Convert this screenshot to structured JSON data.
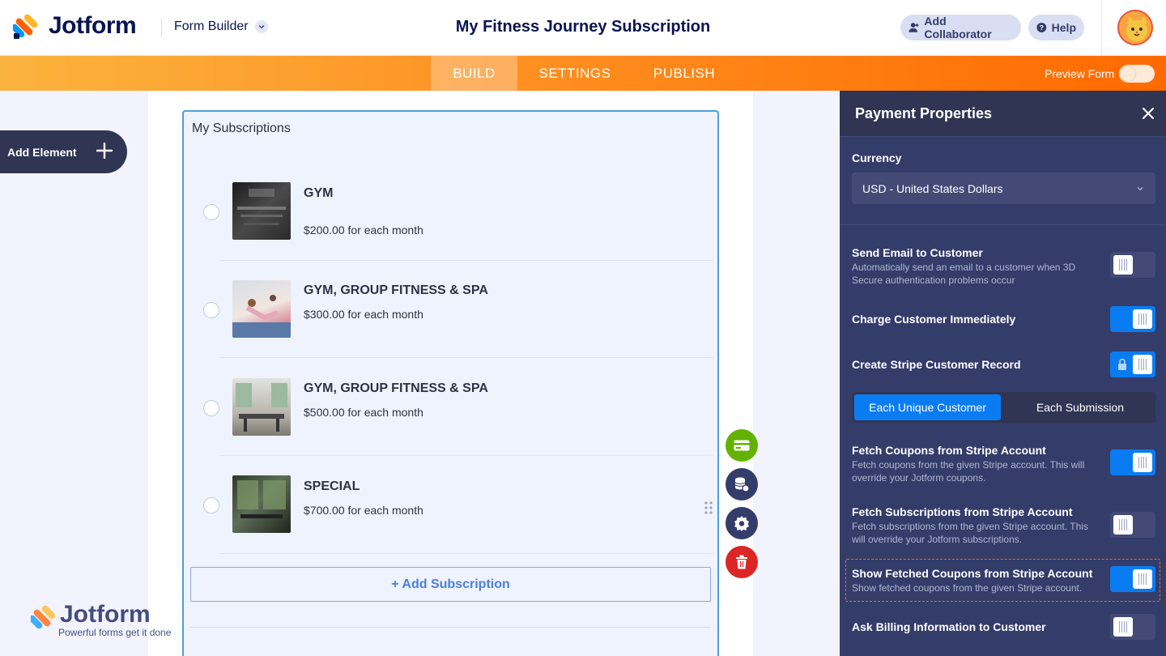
{
  "header": {
    "brand": "Jotform",
    "builder_menu": "Form Builder",
    "form_title": "My Fitness Journey Subscription",
    "add_collaborator": "Add Collaborator",
    "help": "Help"
  },
  "nav": {
    "tabs": [
      "BUILD",
      "SETTINGS",
      "PUBLISH"
    ],
    "active_tab": "BUILD",
    "preview_label": "Preview Form",
    "preview_on": false
  },
  "left": {
    "add_element": "Add Element"
  },
  "widget": {
    "title": "My Subscriptions",
    "items": [
      {
        "name": "GYM",
        "price": "$200.00 for each month",
        "image_icon": "gym-photo"
      },
      {
        "name": "GYM, GROUP FITNESS & SPA",
        "price": "$300.00 for each month",
        "image_icon": "yoga-photo"
      },
      {
        "name": "GYM, GROUP FITNESS & SPA",
        "price": "$500.00 for each month",
        "image_icon": "gym-interior-photo"
      },
      {
        "name": "SPECIAL",
        "price": "$700.00 for each month",
        "image_icon": "gym-window-photo"
      }
    ],
    "add_button": "+ Add Subscription"
  },
  "watermark": {
    "brand": "Jotform",
    "tagline": "Powerful forms get it done"
  },
  "panel": {
    "title": "Payment Properties",
    "currency_label": "Currency",
    "currency_value": "USD - United States Dollars",
    "options": [
      {
        "title": "Send Email to Customer",
        "desc": "Automatically send an email to a customer when 3D Secure authentication problems occur",
        "on": false
      },
      {
        "title": "Charge Customer Immediately",
        "desc": "",
        "on": true
      },
      {
        "title": "Create Stripe Customer Record",
        "desc": "",
        "on": true,
        "locked": true
      },
      {
        "title": "Fetch Coupons from Stripe Account",
        "desc": "Fetch coupons from the given Stripe account. This will override your Jotform coupons.",
        "on": true
      },
      {
        "title": "Fetch Subscriptions from Stripe Account",
        "desc": "Fetch subscriptions from the given Stripe account. This will override your Jotform subscriptions.",
        "on": false
      },
      {
        "title": "Show Fetched Coupons from Stripe Account",
        "desc": "Show fetched coupons from the given Stripe account.",
        "on": true
      },
      {
        "title": "Ask Billing Information to Customer",
        "desc": "",
        "on": false
      }
    ],
    "customer_record_mode": [
      "Each Unique Customer",
      "Each Submission"
    ],
    "customer_record_selected": "Each Unique Customer"
  },
  "colors": {
    "accent_orange": "#ff6a00",
    "toggle_on": "#0a7cf2",
    "panel_bg": "#343c6a",
    "payment_tool": "#64b200",
    "delete_tool": "#dc2626"
  }
}
